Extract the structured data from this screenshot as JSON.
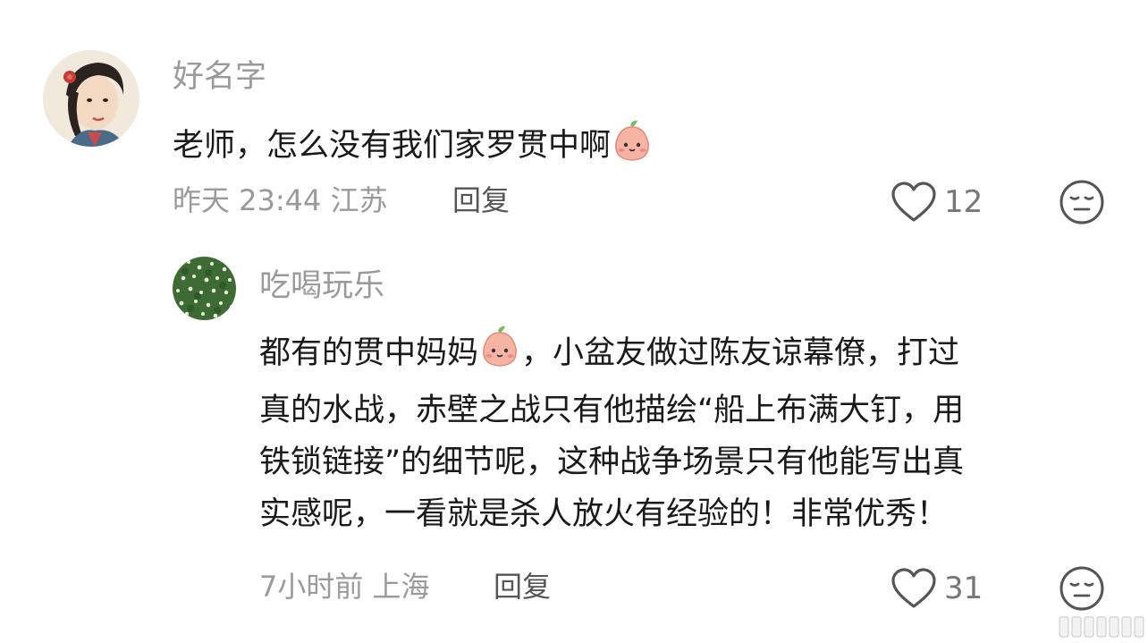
{
  "comment": {
    "author": "好名字",
    "text": "老师，怎么没有我们家罗贯中啊",
    "emoji": "peach-face-emoji",
    "time": "昨天 23:44 江苏",
    "reply_label": "回复",
    "likes": "12"
  },
  "reply": {
    "author": "吃喝玩乐",
    "line1_a": "都有的贯中妈妈",
    "line1_b": "，小盆友做过陈友谅幕僚，打过",
    "line2": "真的水战，赤壁之战只有他描绘“船上布满大钉，用",
    "line3": "铁锁链接”的细节呢，这种战争场景只有他能写出真",
    "line4": "实感呢，一看就是杀人放火有经验的！非常优秀！",
    "emoji": "peach-face-emoji",
    "time": "7小时前 上海",
    "reply_label": "回复",
    "likes": "31"
  },
  "colors": {
    "text": "#1a1a1a",
    "meta": "#9a9a9a",
    "icon": "#555555"
  }
}
